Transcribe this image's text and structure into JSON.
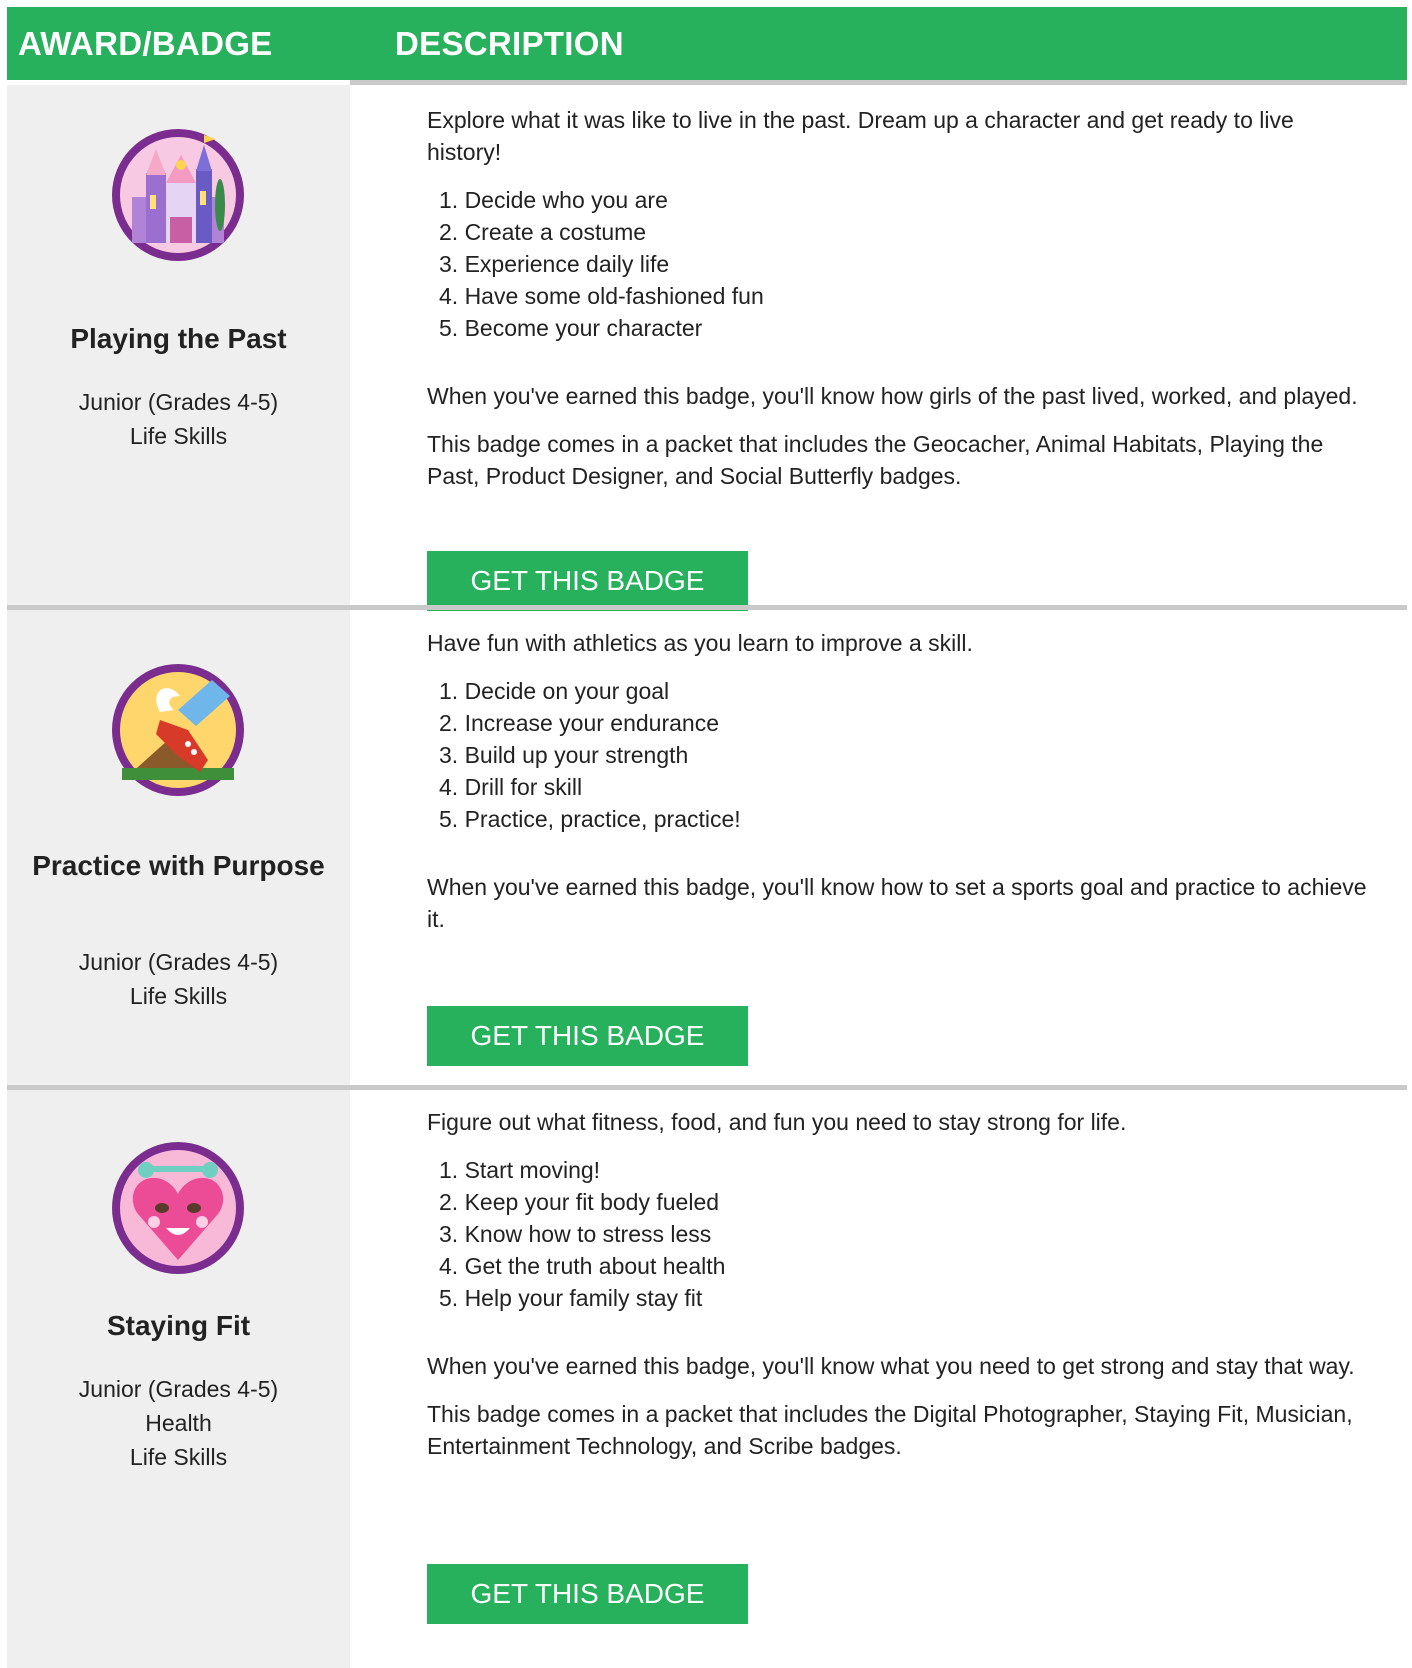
{
  "header": {
    "col_award": "AWARD/BADGE",
    "col_description": "DESCRIPTION"
  },
  "colors": {
    "accent": "#27b15c",
    "left_column_bg": "#efefef",
    "separator": "#c9c9c9",
    "badge_ring": "#7b2c8f"
  },
  "badges": [
    {
      "name": "Playing the Past",
      "icon": "castle-badge-icon",
      "meta": [
        "Junior (Grades 4-5)",
        "Life Skills"
      ],
      "intro": "Explore what it was like to live in the past. Dream up a character and get ready to live history!",
      "steps": [
        "1. Decide who you are",
        "2. Create a costume",
        "3. Experience daily life",
        "4. Have some old-fashioned fun",
        "5. Become your character"
      ],
      "outcome": "When you've earned this badge, you'll know how girls of the past lived, worked, and played.",
      "packet": "This badge comes in a packet that includes the Geocacher, Animal Habitats, Playing the Past, Product Designer, and Social Butterfly badges.",
      "button": "GET THIS BADGE"
    },
    {
      "name": "Practice with Purpose",
      "icon": "winged-shoe-badge-icon",
      "meta": [
        "Junior (Grades 4-5)",
        "Life Skills"
      ],
      "intro": "Have fun with athletics as you learn to improve a skill.",
      "steps": [
        "1. Decide on your goal",
        "2. Increase your endurance",
        "3. Build up your strength",
        "4. Drill for skill",
        "5. Practice, practice, practice!"
      ],
      "outcome": "When you've earned this badge, you'll know how to set a sports goal and practice to achieve it.",
      "button": "GET THIS BADGE"
    },
    {
      "name": "Staying Fit",
      "icon": "heart-badge-icon",
      "meta": [
        "Junior (Grades 4-5)",
        "Health",
        "Life Skills"
      ],
      "intro": "Figure out what fitness, food, and fun you need to stay strong for life.",
      "steps": [
        "1. Start moving!",
        "2. Keep your fit body fueled",
        "3. Know how to stress less",
        "4. Get the truth about health",
        "5. Help your family stay fit"
      ],
      "outcome": "When you've earned this badge, you'll know what you need to get strong and stay that way.",
      "packet": "This badge comes in a packet that includes the Digital Photographer, Staying Fit, Musician, Entertainment Technology, and Scribe badges.",
      "button": "GET THIS BADGE"
    }
  ]
}
